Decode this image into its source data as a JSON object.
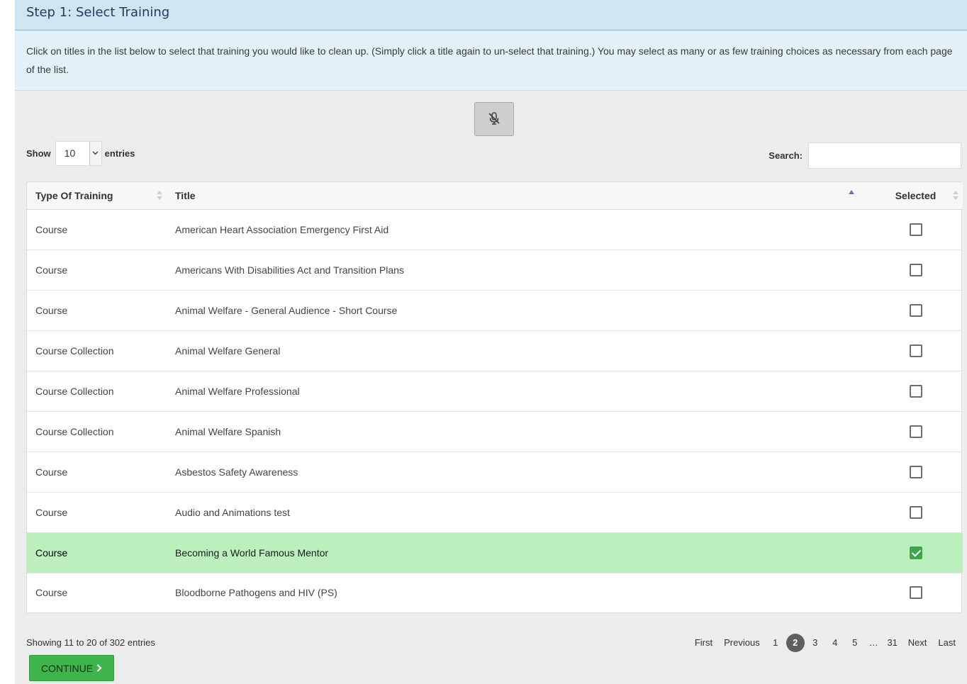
{
  "step": {
    "title": "Step 1: Select Training",
    "instructions": "Click on titles in the list below to select that training you would like to clean up. (Simply click a title again to un-select that training.) You may select as many or as few training choices as necessary from each page of the list."
  },
  "length": {
    "label_before": "Show",
    "value": "10",
    "label_after": "entries"
  },
  "search": {
    "label": "Search:",
    "value": "",
    "placeholder": ""
  },
  "table": {
    "headers": {
      "type": "Type Of Training",
      "title": "Title",
      "selected": "Selected"
    },
    "sorted_column": "title",
    "rows": [
      {
        "type": "Course",
        "title": "American Heart Association Emergency First Aid",
        "selected": false
      },
      {
        "type": "Course",
        "title": "Americans With Disabilities Act and Transition Plans",
        "selected": false
      },
      {
        "type": "Course",
        "title": "Animal Welfare - General Audience - Short Course",
        "selected": false
      },
      {
        "type": "Course Collection",
        "title": "Animal Welfare General",
        "selected": false
      },
      {
        "type": "Course Collection",
        "title": "Animal Welfare Professional",
        "selected": false
      },
      {
        "type": "Course Collection",
        "title": "Animal Welfare Spanish",
        "selected": false
      },
      {
        "type": "Course",
        "title": "Asbestos Safety Awareness",
        "selected": false
      },
      {
        "type": "Course",
        "title": "Audio and Animations test",
        "selected": false
      },
      {
        "type": "Course",
        "title": "Becoming a World Famous Mentor",
        "selected": true
      },
      {
        "type": "Course",
        "title": "Bloodborne Pathogens and HIV (PS)",
        "selected": false
      }
    ]
  },
  "info": "Showing 11 to 20 of 302 entries",
  "pagination": {
    "first": "First",
    "previous": "Previous",
    "pages": [
      "1",
      "2",
      "3",
      "4",
      "5"
    ],
    "current": "2",
    "ellipsis": "…",
    "last_page": "31",
    "next": "Next",
    "last": "Last"
  },
  "continue_label": "CONTINUE",
  "icons": {
    "mic": "microphone-muted-icon",
    "continue": "chevron-right-icon",
    "select": "chevron-down-icon"
  },
  "colors": {
    "header_bg": "#cfe6f2",
    "selected_row": "#bbefbe",
    "checkbox_checked": "#3aa84a",
    "continue_bg": "#3eb54a",
    "current_page": "#5f5f5f"
  }
}
